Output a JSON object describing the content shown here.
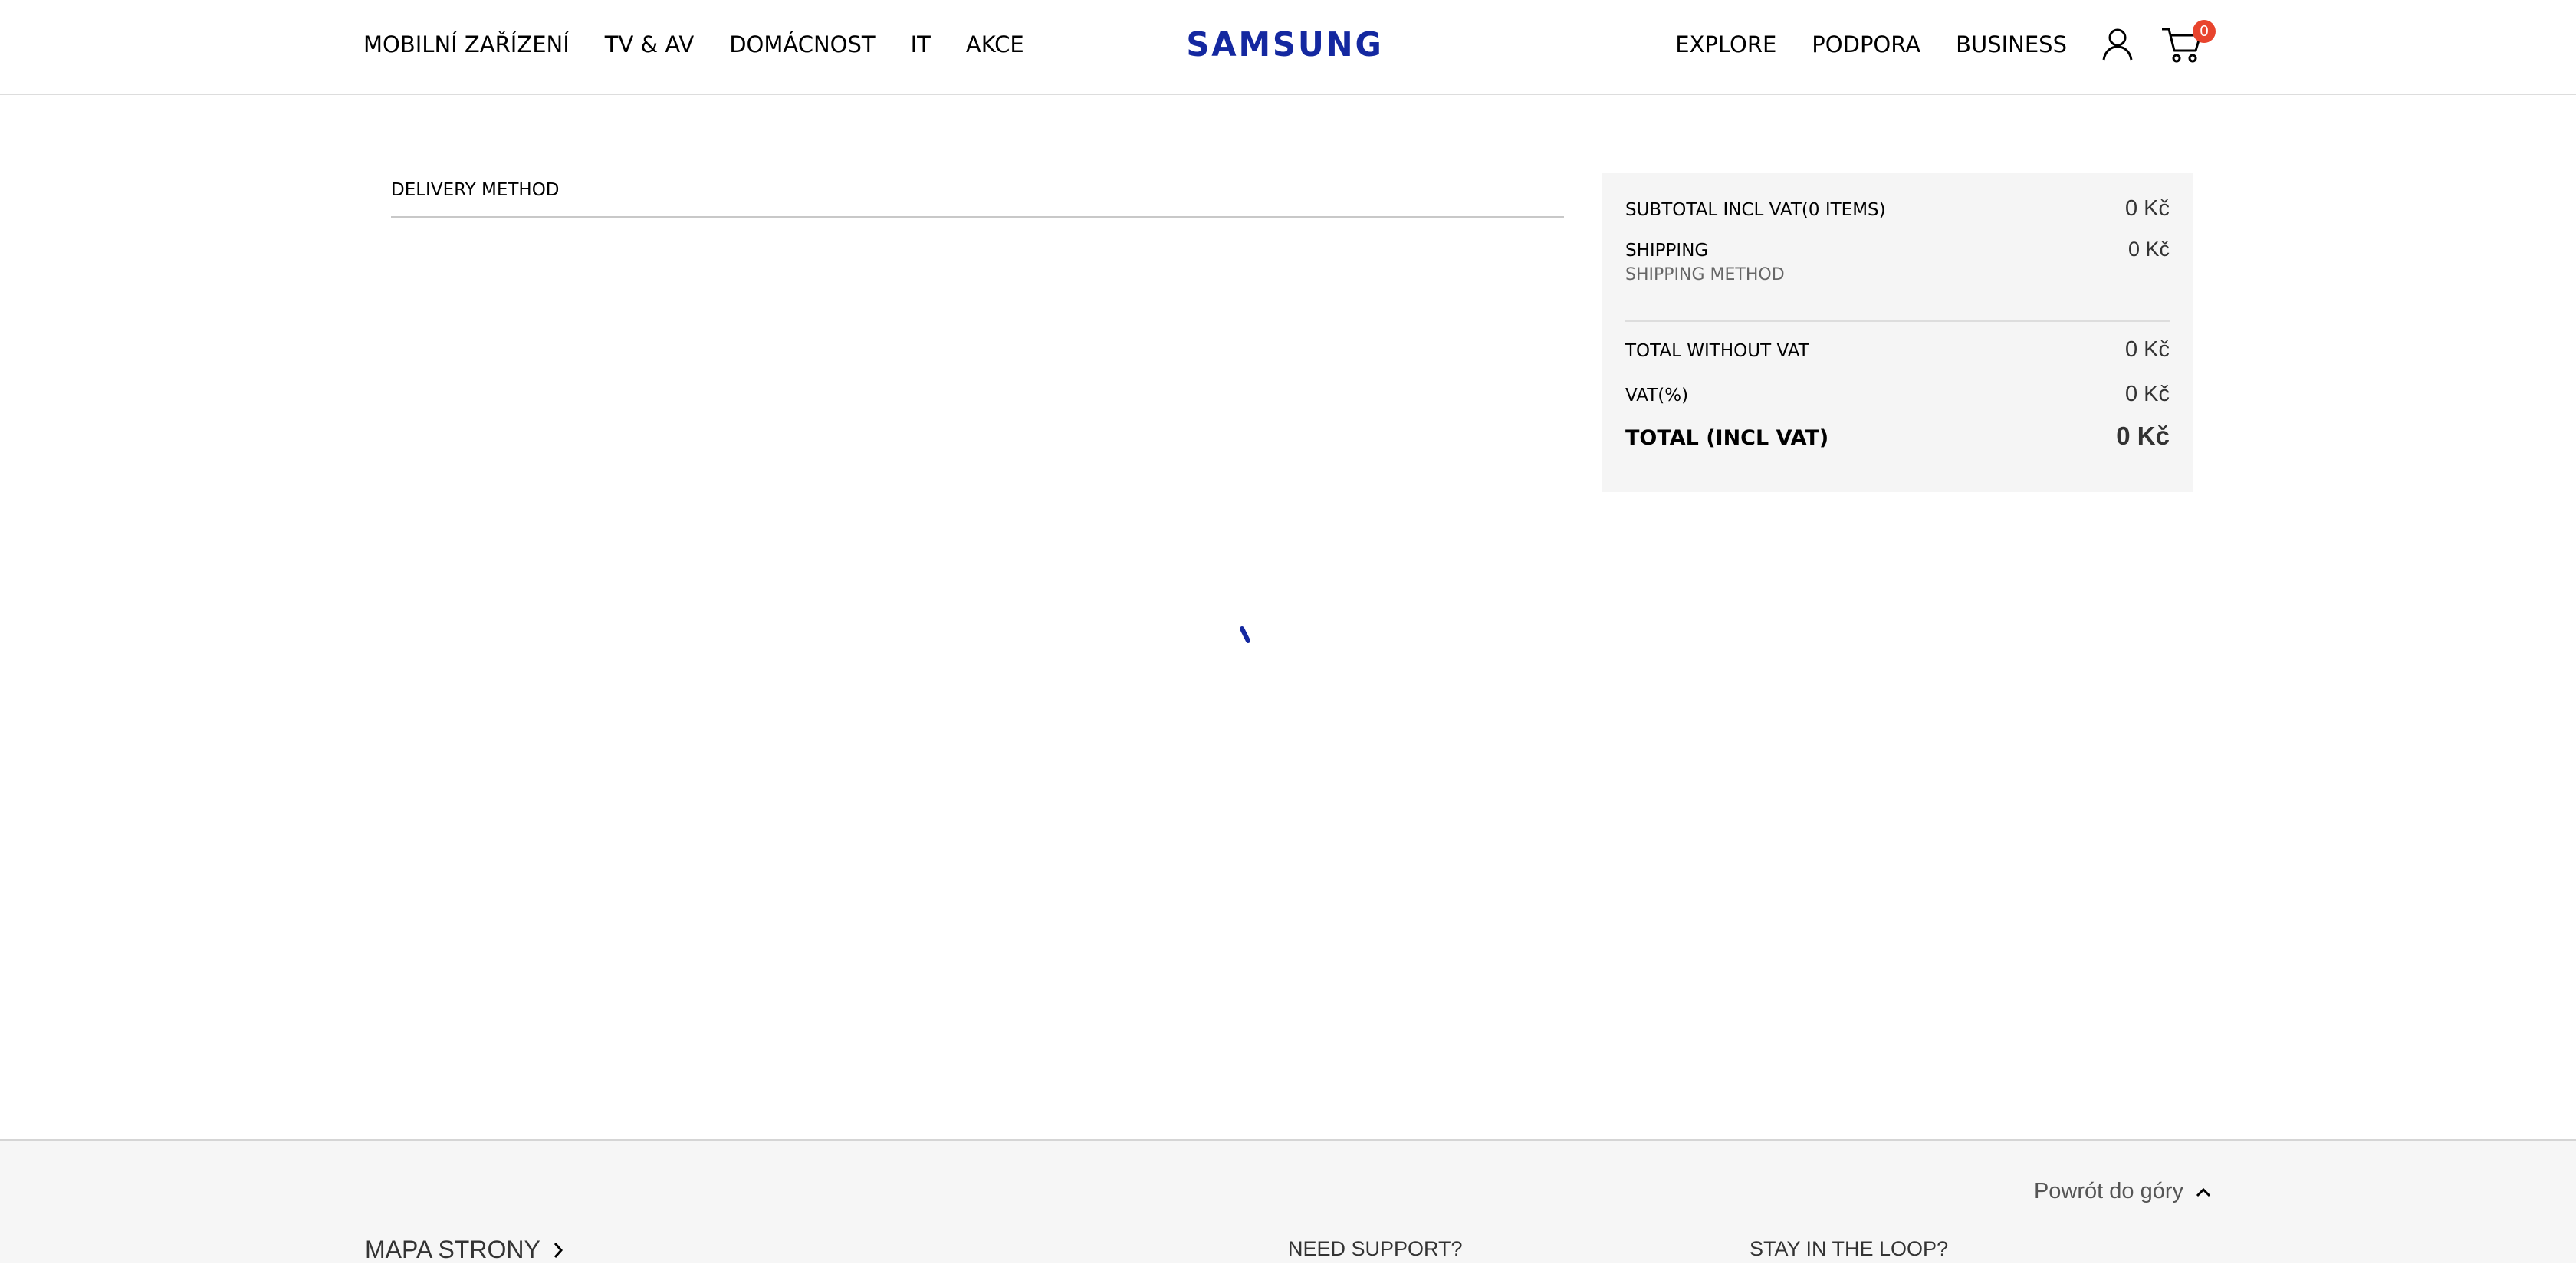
{
  "header": {
    "nav_left": [
      "MOBILNÍ ZAŘÍZENÍ",
      "TV & AV",
      "DOMÁCNOST",
      "IT",
      "AKCE"
    ],
    "logo_text": "SAMSUNG",
    "nav_right": [
      "EXPLORE",
      "PODPORA",
      "BUSINESS"
    ],
    "cart_count": "0",
    "brand_color": "#1428a0",
    "badge_color": "#e8442d"
  },
  "delivery": {
    "title": "DELIVERY METHOD"
  },
  "summary": {
    "subtotal_label": "SUBTOTAL INCL VAT(0 ITEMS)",
    "subtotal_value": "0 Kč",
    "shipping_label": "SHIPPING",
    "shipping_value": "0 Kč",
    "shipping_method": "SHIPPING METHOD",
    "total_without_vat_label": "TOTAL WITHOUT VAT",
    "total_without_vat_value": "0 Kč",
    "vat_label": "VAT(%)",
    "vat_value": "0 Kč",
    "total_label": "TOTAL (INCL VAT)",
    "total_value": "0 Kč"
  },
  "footer": {
    "back_to_top": "Powrót do góry",
    "sitemap": "MAPA STRONY",
    "need_support": "NEED SUPPORT?",
    "stay_in_loop": "STAY IN THE LOOP?"
  },
  "icons": {
    "user": "user-icon",
    "cart": "cart-icon",
    "spinner": "loading-spinner-icon",
    "chevron_right": "chevron-right-icon",
    "chevron_up": "chevron-up-icon"
  }
}
